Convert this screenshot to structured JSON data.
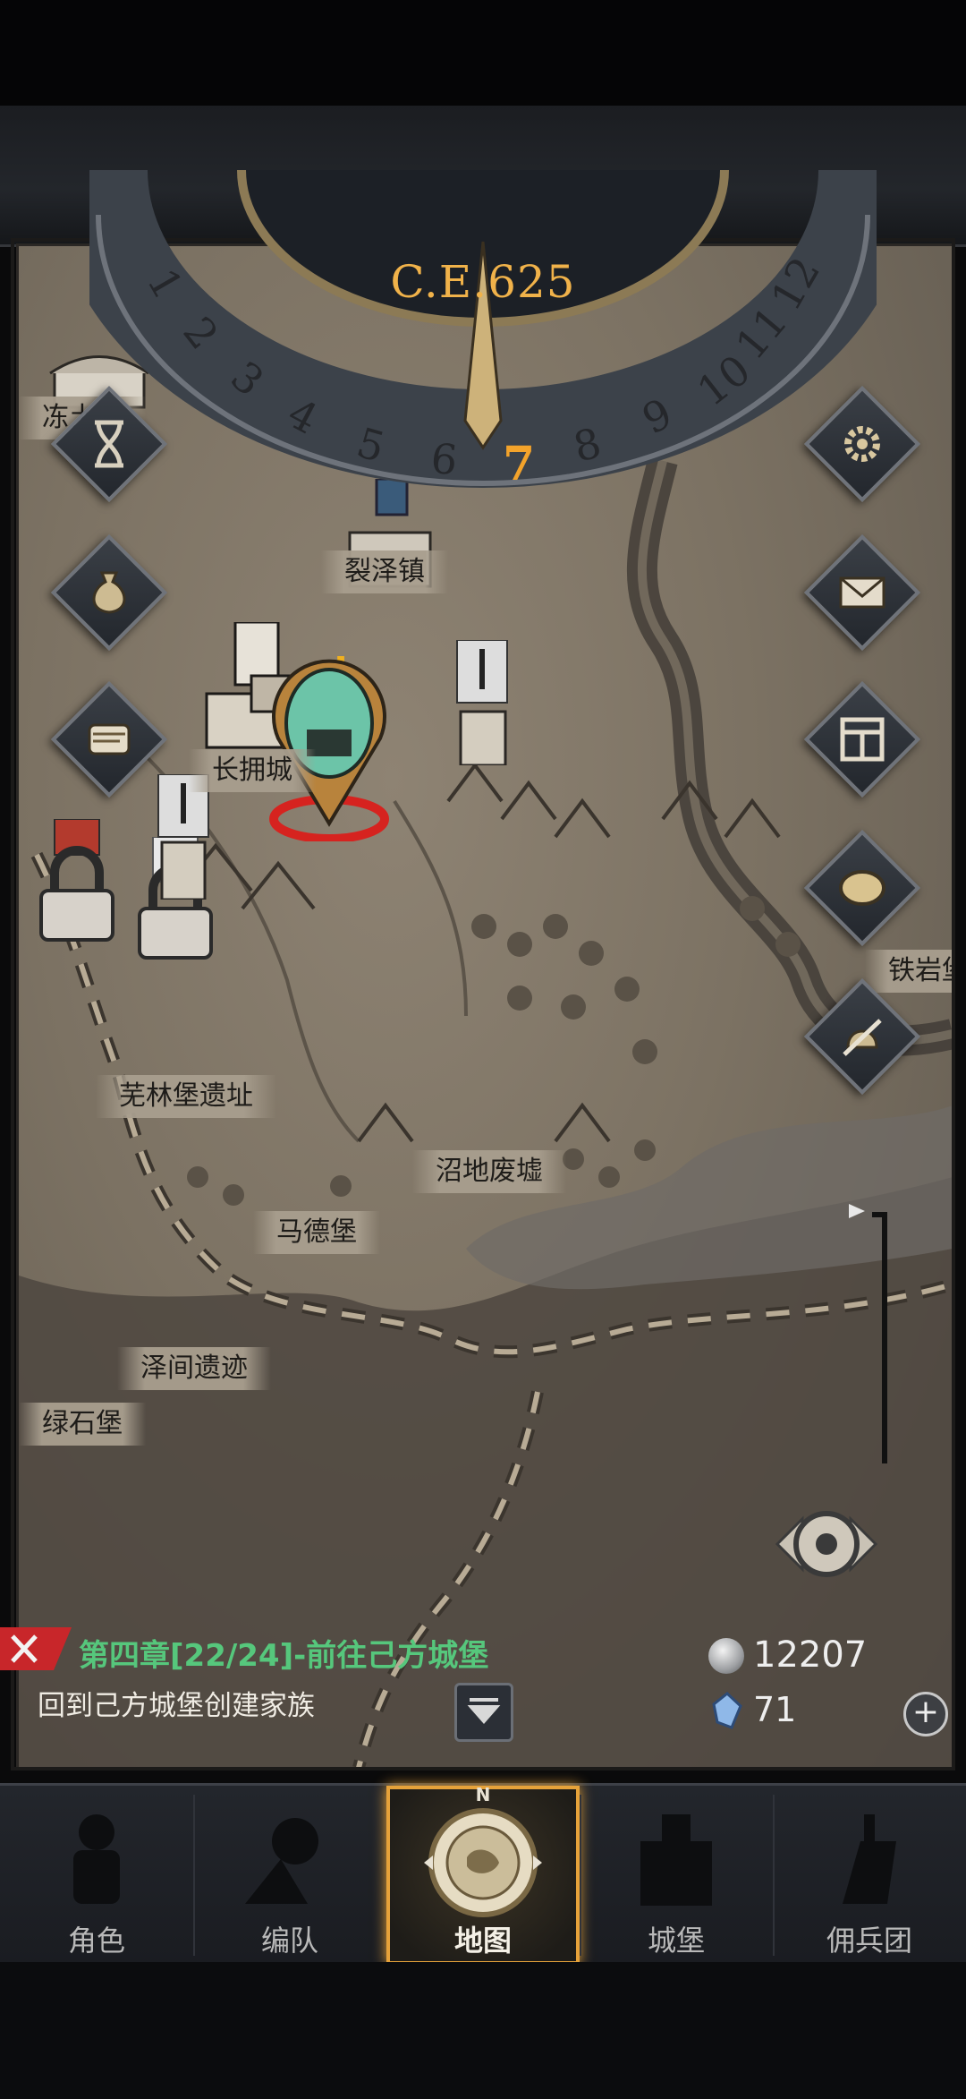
{
  "calendar": {
    "year_label": "C.E.625",
    "months": [
      "1",
      "2",
      "3",
      "4",
      "5",
      "6",
      "7",
      "8",
      "9",
      "10",
      "11",
      "12"
    ],
    "current_month": "7"
  },
  "locations": [
    {
      "id": "dongcun",
      "label": "冻土村"
    },
    {
      "id": "liezezhen",
      "label": "裂泽镇"
    },
    {
      "id": "changyongcheng",
      "label": "长拥城"
    },
    {
      "id": "wulinbao",
      "label": "芜林堡遗址"
    },
    {
      "id": "madebao",
      "label": "马德堡"
    },
    {
      "id": "zhaodi",
      "label": "沼地废墟"
    },
    {
      "id": "zejian",
      "label": "泽间遗迹"
    },
    {
      "id": "lvshibao",
      "label": "绿石堡"
    },
    {
      "id": "tieyan",
      "label": "铁岩堡"
    }
  ],
  "side_buttons": {
    "left": [
      {
        "icon": "hourglass-icon"
      },
      {
        "icon": "money-bag-icon"
      },
      {
        "icon": "scroll-icon"
      }
    ],
    "right": [
      {
        "icon": "gear-icon"
      },
      {
        "icon": "mail-icon"
      },
      {
        "icon": "board-icon"
      },
      {
        "icon": "shield-icon"
      },
      {
        "icon": "helmet-sword-icon"
      }
    ]
  },
  "quest": {
    "title": "第四章[22/24]-前往己方城堡",
    "subtitle": "回到己方城堡创建家族"
  },
  "resources": {
    "silver": "12207",
    "gems": "71",
    "add_symbol": "+"
  },
  "nav": [
    {
      "label": "角色",
      "icon": "knight-icon"
    },
    {
      "label": "编队",
      "icon": "squad-icon"
    },
    {
      "label": "地图",
      "icon": "compass-icon",
      "active": true,
      "compass_letter": "N"
    },
    {
      "label": "城堡",
      "icon": "castle-icon"
    },
    {
      "label": "佣兵团",
      "icon": "mercenary-icon"
    }
  ],
  "colors": {
    "accent_gold": "#f0b24a",
    "quest_green": "#56c77c",
    "nav_active": "#e6a23a"
  }
}
